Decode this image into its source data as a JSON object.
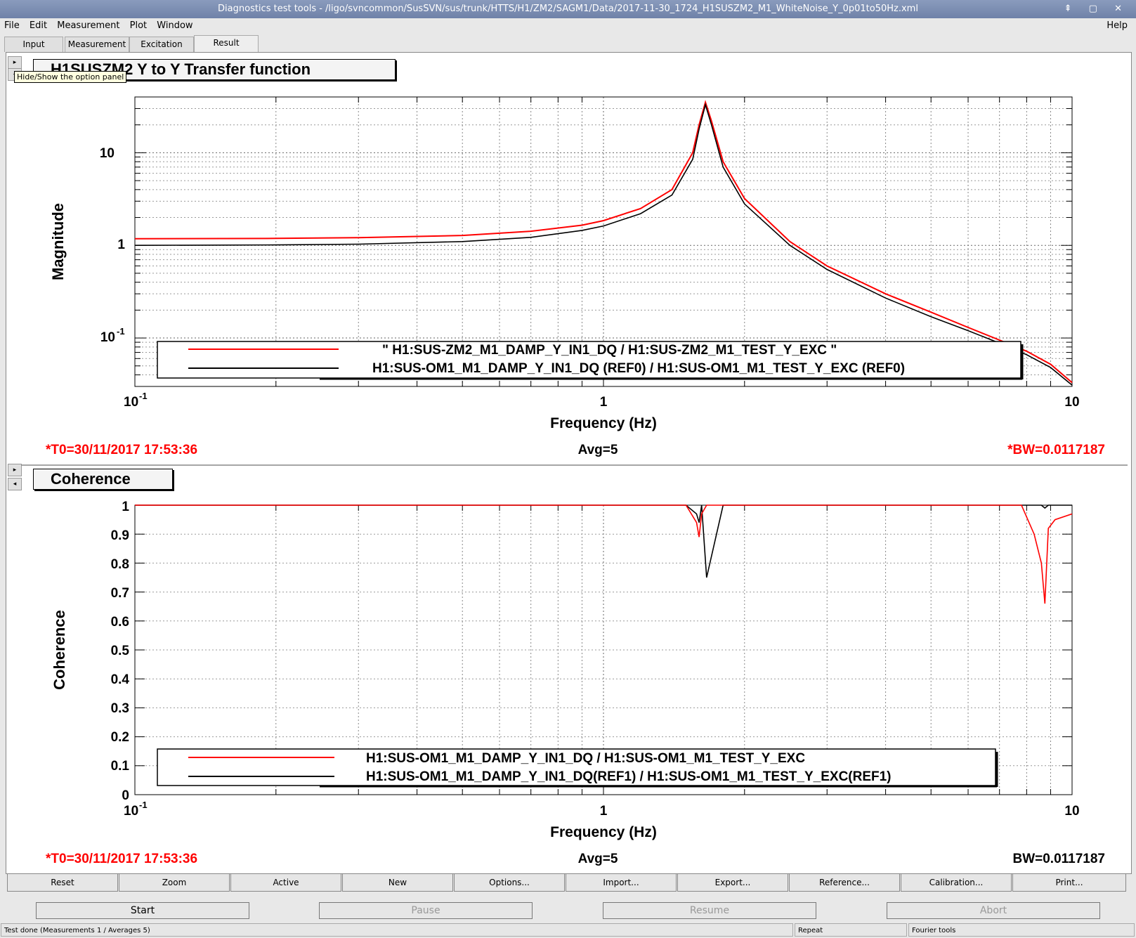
{
  "window": {
    "title": "Diagnostics test tools - /ligo/svncommon/SusSVN/sus/trunk/HTTS/H1/ZM2/SAGM1/Data/2017-11-30_1724_H1SUSZM2_M1_WhiteNoise_Y_0p01to50Hz.xml",
    "controls": "⇞ ▢ ✕"
  },
  "menu": {
    "file": "File",
    "edit": "Edit",
    "measurement": "Measurement",
    "plot": "Plot",
    "window": "Window",
    "help": "Help"
  },
  "tabs": {
    "input": "Input",
    "measurement": "Measurement",
    "excitation": "Excitation",
    "result": "Result"
  },
  "tooltip": "Hide/Show the option panel",
  "top_plot": {
    "title": "H1SUSZM2 Y to Y Transfer function",
    "ylabel": "Magnitude",
    "xlabel": "Frequency (Hz)",
    "yticks": {
      "t10": "10",
      "t1": "1",
      "t01": "10",
      "t01exp": "-1"
    },
    "xticks": {
      "t01": "10",
      "t01exp": "-1",
      "t1": "1",
      "t10": "10"
    },
    "legend": {
      "line1": "\" H1:SUS-ZM2_M1_DAMP_Y_IN1_DQ / H1:SUS-ZM2_M1_TEST_Y_EXC \"",
      "line2": "H1:SUS-OM1_M1_DAMP_Y_IN1_DQ (REF0) / H1:SUS-OM1_M1_TEST_Y_EXC (REF0)"
    },
    "footer": {
      "t0": "*T0=30/11/2017 17:53:36",
      "avg": "Avg=5",
      "bw": "*BW=0.0117187"
    }
  },
  "bottom_plot": {
    "title": "Coherence",
    "ylabel": "Coherence",
    "xlabel": "Frequency (Hz)",
    "yticks": [
      "1",
      "0.9",
      "0.8",
      "0.7",
      "0.6",
      "0.5",
      "0.4",
      "0.3",
      "0.2",
      "0.1",
      "0"
    ],
    "xticks": {
      "t01": "10",
      "t01exp": "-1",
      "t1": "1",
      "t10": "10"
    },
    "legend": {
      "line1": "H1:SUS-OM1_M1_DAMP_Y_IN1_DQ / H1:SUS-OM1_M1_TEST_Y_EXC",
      "line2": "H1:SUS-OM1_M1_DAMP_Y_IN1_DQ(REF1) / H1:SUS-OM1_M1_TEST_Y_EXC(REF1)"
    },
    "footer": {
      "t0": "*T0=30/11/2017 17:53:36",
      "avg": "Avg=5",
      "bw": "BW=0.0117187"
    }
  },
  "buttons": [
    "Reset",
    "Zoom",
    "Active",
    "New",
    "Options...",
    "Import...",
    "Export...",
    "Reference...",
    "Calibration...",
    "Print..."
  ],
  "actions": {
    "start": "Start",
    "pause": "Pause",
    "resume": "Resume",
    "abort": "Abort"
  },
  "status": {
    "left": "Test done (Measurements 1 / Averages 5)",
    "mid": "Repeat",
    "right": "Fourier tools"
  },
  "colors": {
    "red_trace": "#ff0000",
    "black_trace": "#000000",
    "footer_red": "#ff0000"
  },
  "chart_data": [
    {
      "type": "line",
      "title": "H1SUSZM2 Y to Y Transfer function",
      "xlabel": "Frequency (Hz)",
      "ylabel": "Magnitude",
      "xscale": "log",
      "yscale": "log",
      "xlim": [
        0.1,
        10
      ],
      "ylim": [
        0.03,
        40
      ],
      "grid": true,
      "legend_position": "bottom",
      "x": [
        0.1,
        0.2,
        0.3,
        0.5,
        0.7,
        0.9,
        1.0,
        1.2,
        1.4,
        1.55,
        1.6,
        1.65,
        1.7,
        1.8,
        2.0,
        2.5,
        3.0,
        4.0,
        5.0,
        6.0,
        7.0,
        8.0,
        9.0,
        10.0
      ],
      "series": [
        {
          "name": "\" H1:SUS-ZM2_M1_DAMP_Y_IN1_DQ / H1:SUS-ZM2_M1_TEST_Y_EXC \"",
          "values": [
            1.18,
            1.19,
            1.21,
            1.28,
            1.42,
            1.65,
            1.85,
            2.5,
            4.0,
            10.0,
            20.0,
            35.0,
            22.0,
            8.0,
            3.2,
            1.1,
            0.6,
            0.3,
            0.19,
            0.13,
            0.095,
            0.072,
            0.052,
            0.033
          ]
        },
        {
          "name": "H1:SUS-OM1_M1_DAMP_Y_IN1_DQ (REF0) / H1:SUS-OM1_M1_TEST_Y_EXC (REF0)",
          "values": [
            1.0,
            1.01,
            1.03,
            1.1,
            1.22,
            1.45,
            1.62,
            2.2,
            3.5,
            8.5,
            18.0,
            33.0,
            20.0,
            7.0,
            2.8,
            1.0,
            0.55,
            0.27,
            0.17,
            0.12,
            0.088,
            0.066,
            0.048,
            0.031
          ]
        }
      ]
    },
    {
      "type": "line",
      "title": "Coherence",
      "xlabel": "Frequency (Hz)",
      "ylabel": "Coherence",
      "xscale": "log",
      "xlim": [
        0.1,
        10
      ],
      "ylim": [
        0,
        1
      ],
      "grid": true,
      "legend_position": "bottom",
      "x": [
        0.1,
        1.5,
        1.58,
        1.6,
        1.62,
        1.66,
        1.8,
        7.8,
        8.3,
        8.6,
        8.75,
        8.9,
        9.2,
        10.0
      ],
      "series": [
        {
          "name": "H1:SUS-OM1_M1_DAMP_Y_IN1_DQ / H1:SUS-OM1_M1_TEST_Y_EXC",
          "values": [
            1.0,
            1.0,
            0.94,
            0.89,
            0.97,
            1.0,
            1.0,
            1.0,
            0.9,
            0.8,
            0.66,
            0.92,
            0.95,
            0.97
          ]
        },
        {
          "name": "H1:SUS-OM1_M1_DAMP_Y_IN1_DQ(REF1) / H1:SUS-OM1_M1_TEST_Y_EXC(REF1)",
          "values": [
            1.0,
            1.0,
            0.97,
            0.94,
            1.0,
            0.75,
            1.0,
            1.0,
            1.0,
            1.0,
            0.99,
            1.0,
            1.0,
            1.0
          ]
        }
      ]
    }
  ]
}
